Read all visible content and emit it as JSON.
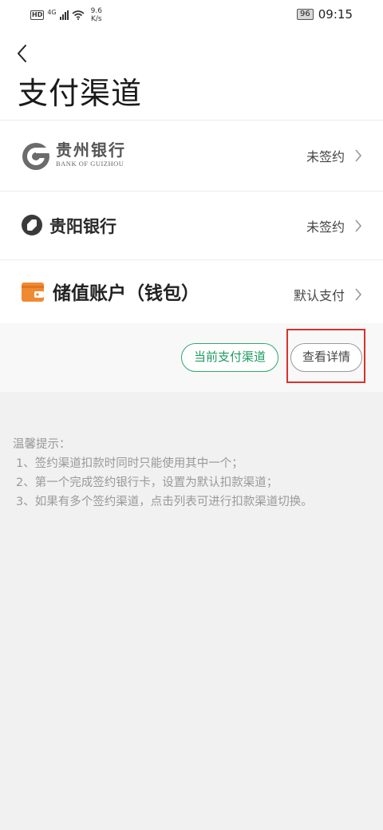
{
  "status_bar": {
    "hd": "HD",
    "net": "4G",
    "speed_value": "9.6",
    "speed_unit": "K/s",
    "battery": "96",
    "time": "09:15"
  },
  "header": {
    "title": "支付渠道"
  },
  "channels": [
    {
      "name_cn": "贵州银行",
      "name_en": "BANK OF GUIZHOU",
      "status": "未签约"
    },
    {
      "name": "贵阳银行",
      "status": "未签约"
    },
    {
      "name": "储值账户（钱包）",
      "status": "默认支付"
    }
  ],
  "actions": {
    "current_channel": "当前支付渠道",
    "view_details": "查看详情"
  },
  "tips": {
    "heading": "温馨提示：",
    "lines": [
      "1、签约渠道扣款时同时只能使用其中一个；",
      "2、第一个完成签约银行卡，设置为默认扣款渠道；",
      "3、如果有多个签约渠道，点击列表可进行扣款渠道切换。"
    ]
  },
  "colors": {
    "accent_green": "#1f9a62",
    "highlight_red": "#d9322b",
    "wallet_orange": "#f08a32"
  },
  "icons": [
    "back-arrow-icon",
    "chevron-right-icon",
    "guizhou-bank-logo",
    "guiyang-bank-logo",
    "wallet-icon"
  ]
}
